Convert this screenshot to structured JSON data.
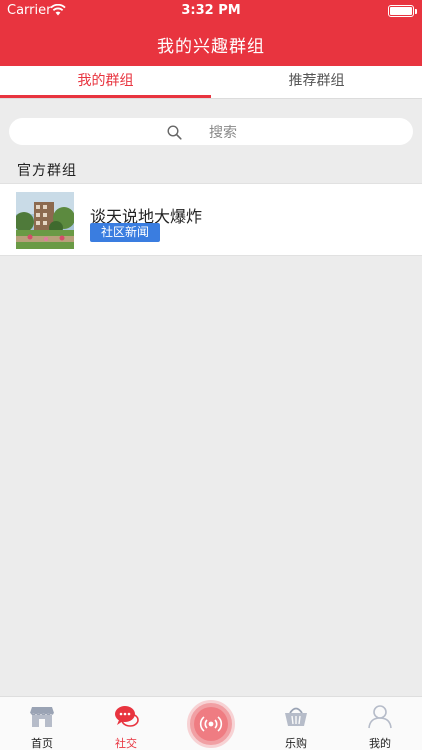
{
  "status_bar": {
    "carrier": "Carrier",
    "time": "3:32 PM"
  },
  "nav": {
    "title": "我的兴趣群组"
  },
  "tabs": [
    {
      "label": "我的群组",
      "active": true
    },
    {
      "label": "推荐群组",
      "active": false
    }
  ],
  "search": {
    "placeholder": "搜索"
  },
  "section": {
    "title": "官方群组"
  },
  "groups": [
    {
      "name": "谈天说地大爆炸",
      "tag": "社区新闻"
    }
  ],
  "tabbar": {
    "items": [
      {
        "label": "首页",
        "icon": "storefront-icon",
        "active": false
      },
      {
        "label": "社交",
        "icon": "chat-bubbles-icon",
        "active": true
      },
      {
        "label": "乐购",
        "icon": "basket-icon",
        "active": false
      },
      {
        "label": "我的",
        "icon": "person-icon",
        "active": false
      }
    ],
    "center_icon": "broadcast-icon"
  },
  "colors": {
    "brand_red": "#e8343f",
    "tag_blue": "#3a7de0",
    "background": "#ececec"
  }
}
